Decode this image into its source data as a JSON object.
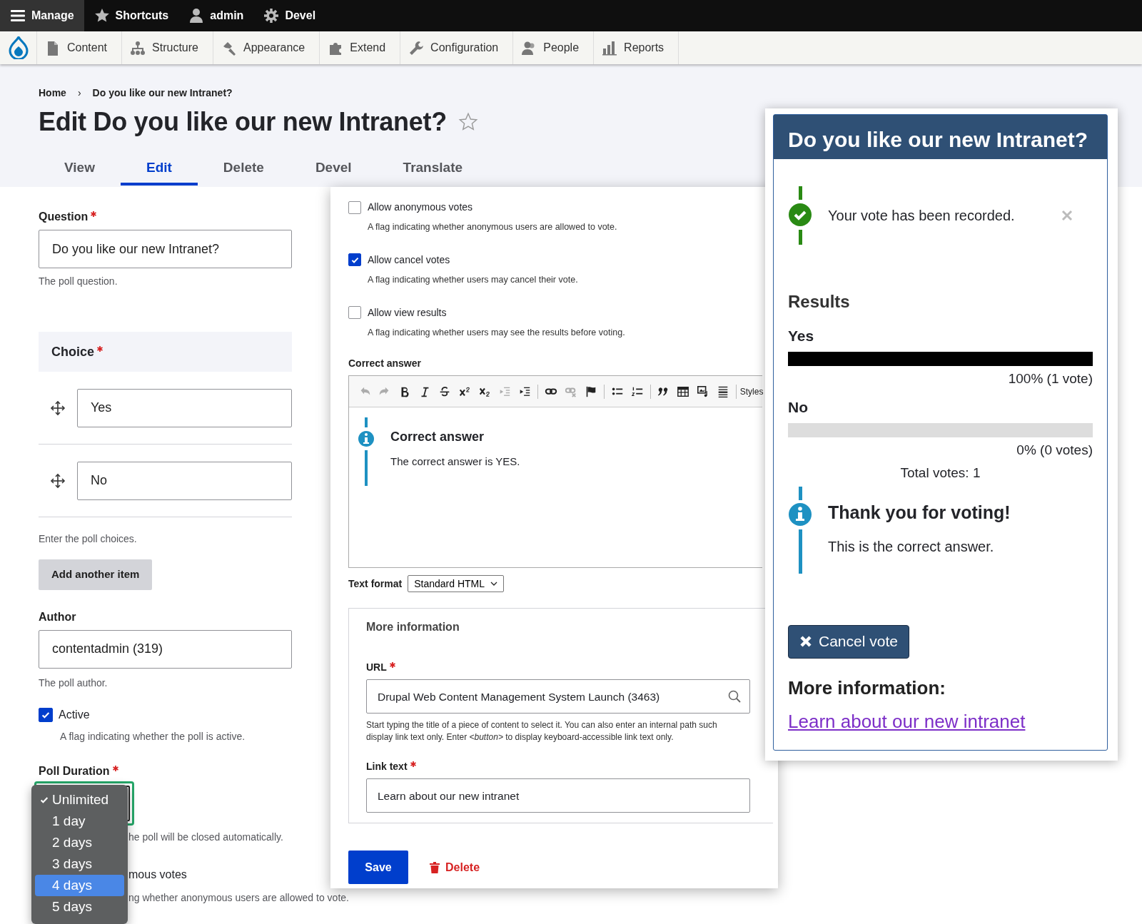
{
  "toolbar": [
    {
      "label": "Manage",
      "kind": "menu",
      "selected": true
    },
    {
      "label": "Shortcuts",
      "kind": "star",
      "selected": false
    },
    {
      "label": "admin",
      "kind": "user",
      "selected": false
    },
    {
      "label": "Devel",
      "kind": "gear",
      "selected": false
    }
  ],
  "admin_menu": [
    {
      "label": "Content",
      "kind": "content"
    },
    {
      "label": "Structure",
      "kind": "structure"
    },
    {
      "label": "Appearance",
      "kind": "appearance"
    },
    {
      "label": "Extend",
      "kind": "extend"
    },
    {
      "label": "Configuration",
      "kind": "configuration"
    },
    {
      "label": "People",
      "kind": "people"
    },
    {
      "label": "Reports",
      "kind": "reports"
    }
  ],
  "breadcrumb": {
    "items": [
      "Home",
      "Do you like our new Intranet?"
    ],
    "separator": "›"
  },
  "page_title": "Edit Do you like our new Intranet?",
  "favorite": false,
  "tabs": [
    {
      "label": "View",
      "selected": false
    },
    {
      "label": "Edit",
      "selected": true
    },
    {
      "label": "Delete",
      "selected": false
    },
    {
      "label": "Devel",
      "selected": false
    },
    {
      "label": "Translate",
      "selected": false
    }
  ],
  "form": {
    "question": {
      "label": "Question",
      "required": true,
      "value": "Do you like our new Intranet?",
      "description": "The poll question."
    },
    "choice": {
      "label": "Choice",
      "required": true,
      "items": [
        "Yes",
        "No"
      ],
      "description": "Enter the poll choices.",
      "add_button": "Add another item"
    },
    "author": {
      "label": "Author",
      "value": "contentadmin (319)",
      "description": "The poll author."
    },
    "active": {
      "label": "Active",
      "checked": true,
      "description": "A flag indicating whether the poll is active."
    },
    "poll_duration": {
      "label": "Poll Duration",
      "required": true,
      "description": "he poll will be closed automatically.",
      "options": [
        {
          "label": "Unlimited",
          "checked": true,
          "highlighted": false
        },
        {
          "label": "1 day",
          "checked": false,
          "highlighted": false
        },
        {
          "label": "2 days",
          "checked": false,
          "highlighted": false
        },
        {
          "label": "3 days",
          "checked": false,
          "highlighted": false
        },
        {
          "label": "4 days",
          "checked": false,
          "highlighted": true
        },
        {
          "label": "5 days",
          "checked": false,
          "highlighted": false
        }
      ]
    },
    "anonymous": {
      "label": "mous votes",
      "description": "ng whether anonymous users are allowed to vote."
    }
  },
  "settings_panel": {
    "checkboxes": [
      {
        "label": "Allow anonymous votes",
        "checked": false,
        "description": "A flag indicating whether anonymous users are allowed to vote."
      },
      {
        "label": "Allow cancel votes",
        "checked": true,
        "description": "A flag indicating whether users may cancel their vote."
      },
      {
        "label": "Allow view results",
        "checked": false,
        "description": "A flag indicating whether users may see the results before voting."
      }
    ],
    "correct_answer": {
      "label": "Correct answer",
      "toolbar": [
        {
          "kind": "undo",
          "disabled": true
        },
        {
          "kind": "redo",
          "disabled": true
        },
        {
          "kind": "bold",
          "disabled": false
        },
        {
          "kind": "italic",
          "disabled": false
        },
        {
          "kind": "strike",
          "disabled": false
        },
        {
          "kind": "superscript",
          "disabled": false
        },
        {
          "kind": "subscript",
          "disabled": false
        },
        {
          "kind": "outdent",
          "disabled": true
        },
        {
          "kind": "indent",
          "disabled": false
        },
        {
          "kind": "link",
          "disabled": false
        },
        {
          "kind": "unlink",
          "disabled": true
        },
        {
          "kind": "anchor",
          "disabled": false
        },
        {
          "kind": "bullets",
          "disabled": false
        },
        {
          "kind": "numbers",
          "disabled": false
        },
        {
          "kind": "quote",
          "disabled": false
        },
        {
          "kind": "table",
          "disabled": false
        },
        {
          "kind": "media",
          "disabled": false
        },
        {
          "kind": "rule",
          "disabled": false
        },
        {
          "kind": "styles",
          "label": "Styles",
          "disabled": false
        }
      ],
      "callout": {
        "title": "Correct answer",
        "text": "The correct answer is YES."
      },
      "text_format_label": "Text format",
      "text_format": "Standard HTML"
    },
    "more_information": {
      "title": "More information",
      "url": {
        "label": "URL",
        "required": true,
        "value": "Drupal Web Content Management System Launch (3463)",
        "description_lines": [
          "Start typing the title of a piece of content to select it. You can also enter an internal path such",
          "display link text only. Enter *<button>* to display keyboard-accessible link text only."
        ]
      },
      "link_text": {
        "label": "Link text",
        "required": true,
        "value": "Learn about our new intranet"
      }
    },
    "save": "Save",
    "delete": "Delete"
  },
  "poll_block": {
    "title": "Do you like our new Intranet?",
    "status": {
      "text": "Your vote has been recorded."
    },
    "results_title": "Results",
    "results": [
      {
        "label": "Yes",
        "level": 1,
        "reading": "100% (1 vote)"
      },
      {
        "label": "No",
        "level": 0,
        "reading": "0% (0 votes)"
      }
    ],
    "total": "Total votes: 1",
    "info": {
      "title": "Thank you for voting!",
      "text": "This is the correct answer."
    },
    "cancel_button": "Cancel vote",
    "more_info_label": "More information:",
    "more_info_link": "Learn about our new intranet"
  }
}
